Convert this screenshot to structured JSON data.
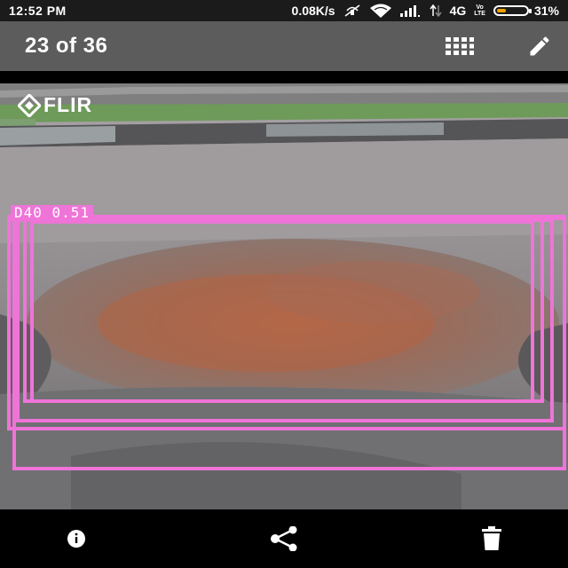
{
  "status_bar": {
    "time": "12:52 PM",
    "net_speed": "0.08K/s",
    "network_type": "4G",
    "lte_badge_top": "Vo",
    "lte_badge_bottom": "LTE",
    "battery_percent": "31%",
    "battery_level": 0.31,
    "battery_color": "#f4a300",
    "icons": [
      "mute-icon",
      "wifi-icon",
      "signal-icon",
      "data-arrows-icon",
      "battery-icon"
    ]
  },
  "app_bar": {
    "counter": "23 of 36",
    "actions": [
      "grid-view-icon",
      "edit-icon"
    ]
  },
  "photo": {
    "logo_text": "FLIR",
    "detection": {
      "label": "D40 0.51",
      "color": "#ef74d8"
    }
  },
  "bottom_bar": {
    "actions": [
      "info-icon",
      "share-icon",
      "delete-icon"
    ]
  }
}
